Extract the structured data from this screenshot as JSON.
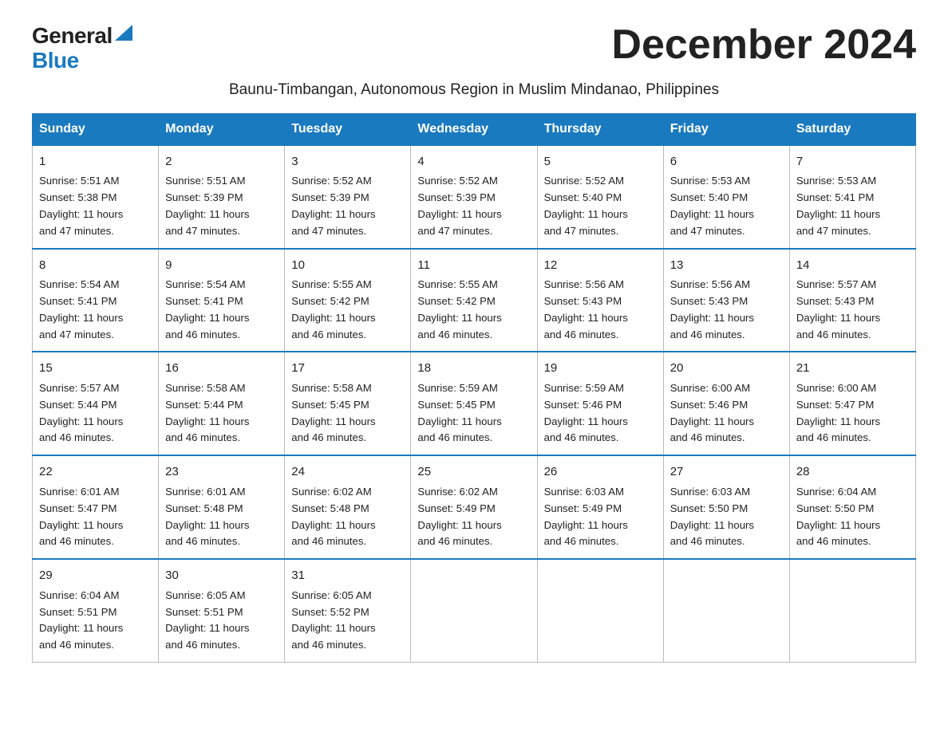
{
  "logo": {
    "general": "General",
    "blue": "Blue"
  },
  "title": "December 2024",
  "subtitle": "Baunu-Timbangan, Autonomous Region in Muslim Mindanao, Philippines",
  "headers": [
    "Sunday",
    "Monday",
    "Tuesday",
    "Wednesday",
    "Thursday",
    "Friday",
    "Saturday"
  ],
  "weeks": [
    [
      {
        "day": "1",
        "sunrise": "5:51 AM",
        "sunset": "5:38 PM",
        "daylight": "11 hours and 47 minutes."
      },
      {
        "day": "2",
        "sunrise": "5:51 AM",
        "sunset": "5:39 PM",
        "daylight": "11 hours and 47 minutes."
      },
      {
        "day": "3",
        "sunrise": "5:52 AM",
        "sunset": "5:39 PM",
        "daylight": "11 hours and 47 minutes."
      },
      {
        "day": "4",
        "sunrise": "5:52 AM",
        "sunset": "5:39 PM",
        "daylight": "11 hours and 47 minutes."
      },
      {
        "day": "5",
        "sunrise": "5:52 AM",
        "sunset": "5:40 PM",
        "daylight": "11 hours and 47 minutes."
      },
      {
        "day": "6",
        "sunrise": "5:53 AM",
        "sunset": "5:40 PM",
        "daylight": "11 hours and 47 minutes."
      },
      {
        "day": "7",
        "sunrise": "5:53 AM",
        "sunset": "5:41 PM",
        "daylight": "11 hours and 47 minutes."
      }
    ],
    [
      {
        "day": "8",
        "sunrise": "5:54 AM",
        "sunset": "5:41 PM",
        "daylight": "11 hours and 47 minutes."
      },
      {
        "day": "9",
        "sunrise": "5:54 AM",
        "sunset": "5:41 PM",
        "daylight": "11 hours and 46 minutes."
      },
      {
        "day": "10",
        "sunrise": "5:55 AM",
        "sunset": "5:42 PM",
        "daylight": "11 hours and 46 minutes."
      },
      {
        "day": "11",
        "sunrise": "5:55 AM",
        "sunset": "5:42 PM",
        "daylight": "11 hours and 46 minutes."
      },
      {
        "day": "12",
        "sunrise": "5:56 AM",
        "sunset": "5:43 PM",
        "daylight": "11 hours and 46 minutes."
      },
      {
        "day": "13",
        "sunrise": "5:56 AM",
        "sunset": "5:43 PM",
        "daylight": "11 hours and 46 minutes."
      },
      {
        "day": "14",
        "sunrise": "5:57 AM",
        "sunset": "5:43 PM",
        "daylight": "11 hours and 46 minutes."
      }
    ],
    [
      {
        "day": "15",
        "sunrise": "5:57 AM",
        "sunset": "5:44 PM",
        "daylight": "11 hours and 46 minutes."
      },
      {
        "day": "16",
        "sunrise": "5:58 AM",
        "sunset": "5:44 PM",
        "daylight": "11 hours and 46 minutes."
      },
      {
        "day": "17",
        "sunrise": "5:58 AM",
        "sunset": "5:45 PM",
        "daylight": "11 hours and 46 minutes."
      },
      {
        "day": "18",
        "sunrise": "5:59 AM",
        "sunset": "5:45 PM",
        "daylight": "11 hours and 46 minutes."
      },
      {
        "day": "19",
        "sunrise": "5:59 AM",
        "sunset": "5:46 PM",
        "daylight": "11 hours and 46 minutes."
      },
      {
        "day": "20",
        "sunrise": "6:00 AM",
        "sunset": "5:46 PM",
        "daylight": "11 hours and 46 minutes."
      },
      {
        "day": "21",
        "sunrise": "6:00 AM",
        "sunset": "5:47 PM",
        "daylight": "11 hours and 46 minutes."
      }
    ],
    [
      {
        "day": "22",
        "sunrise": "6:01 AM",
        "sunset": "5:47 PM",
        "daylight": "11 hours and 46 minutes."
      },
      {
        "day": "23",
        "sunrise": "6:01 AM",
        "sunset": "5:48 PM",
        "daylight": "11 hours and 46 minutes."
      },
      {
        "day": "24",
        "sunrise": "6:02 AM",
        "sunset": "5:48 PM",
        "daylight": "11 hours and 46 minutes."
      },
      {
        "day": "25",
        "sunrise": "6:02 AM",
        "sunset": "5:49 PM",
        "daylight": "11 hours and 46 minutes."
      },
      {
        "day": "26",
        "sunrise": "6:03 AM",
        "sunset": "5:49 PM",
        "daylight": "11 hours and 46 minutes."
      },
      {
        "day": "27",
        "sunrise": "6:03 AM",
        "sunset": "5:50 PM",
        "daylight": "11 hours and 46 minutes."
      },
      {
        "day": "28",
        "sunrise": "6:04 AM",
        "sunset": "5:50 PM",
        "daylight": "11 hours and 46 minutes."
      }
    ],
    [
      {
        "day": "29",
        "sunrise": "6:04 AM",
        "sunset": "5:51 PM",
        "daylight": "11 hours and 46 minutes."
      },
      {
        "day": "30",
        "sunrise": "6:05 AM",
        "sunset": "5:51 PM",
        "daylight": "11 hours and 46 minutes."
      },
      {
        "day": "31",
        "sunrise": "6:05 AM",
        "sunset": "5:52 PM",
        "daylight": "11 hours and 46 minutes."
      },
      null,
      null,
      null,
      null
    ]
  ],
  "labels": {
    "sunrise": "Sunrise:",
    "sunset": "Sunset:",
    "daylight": "Daylight:"
  }
}
